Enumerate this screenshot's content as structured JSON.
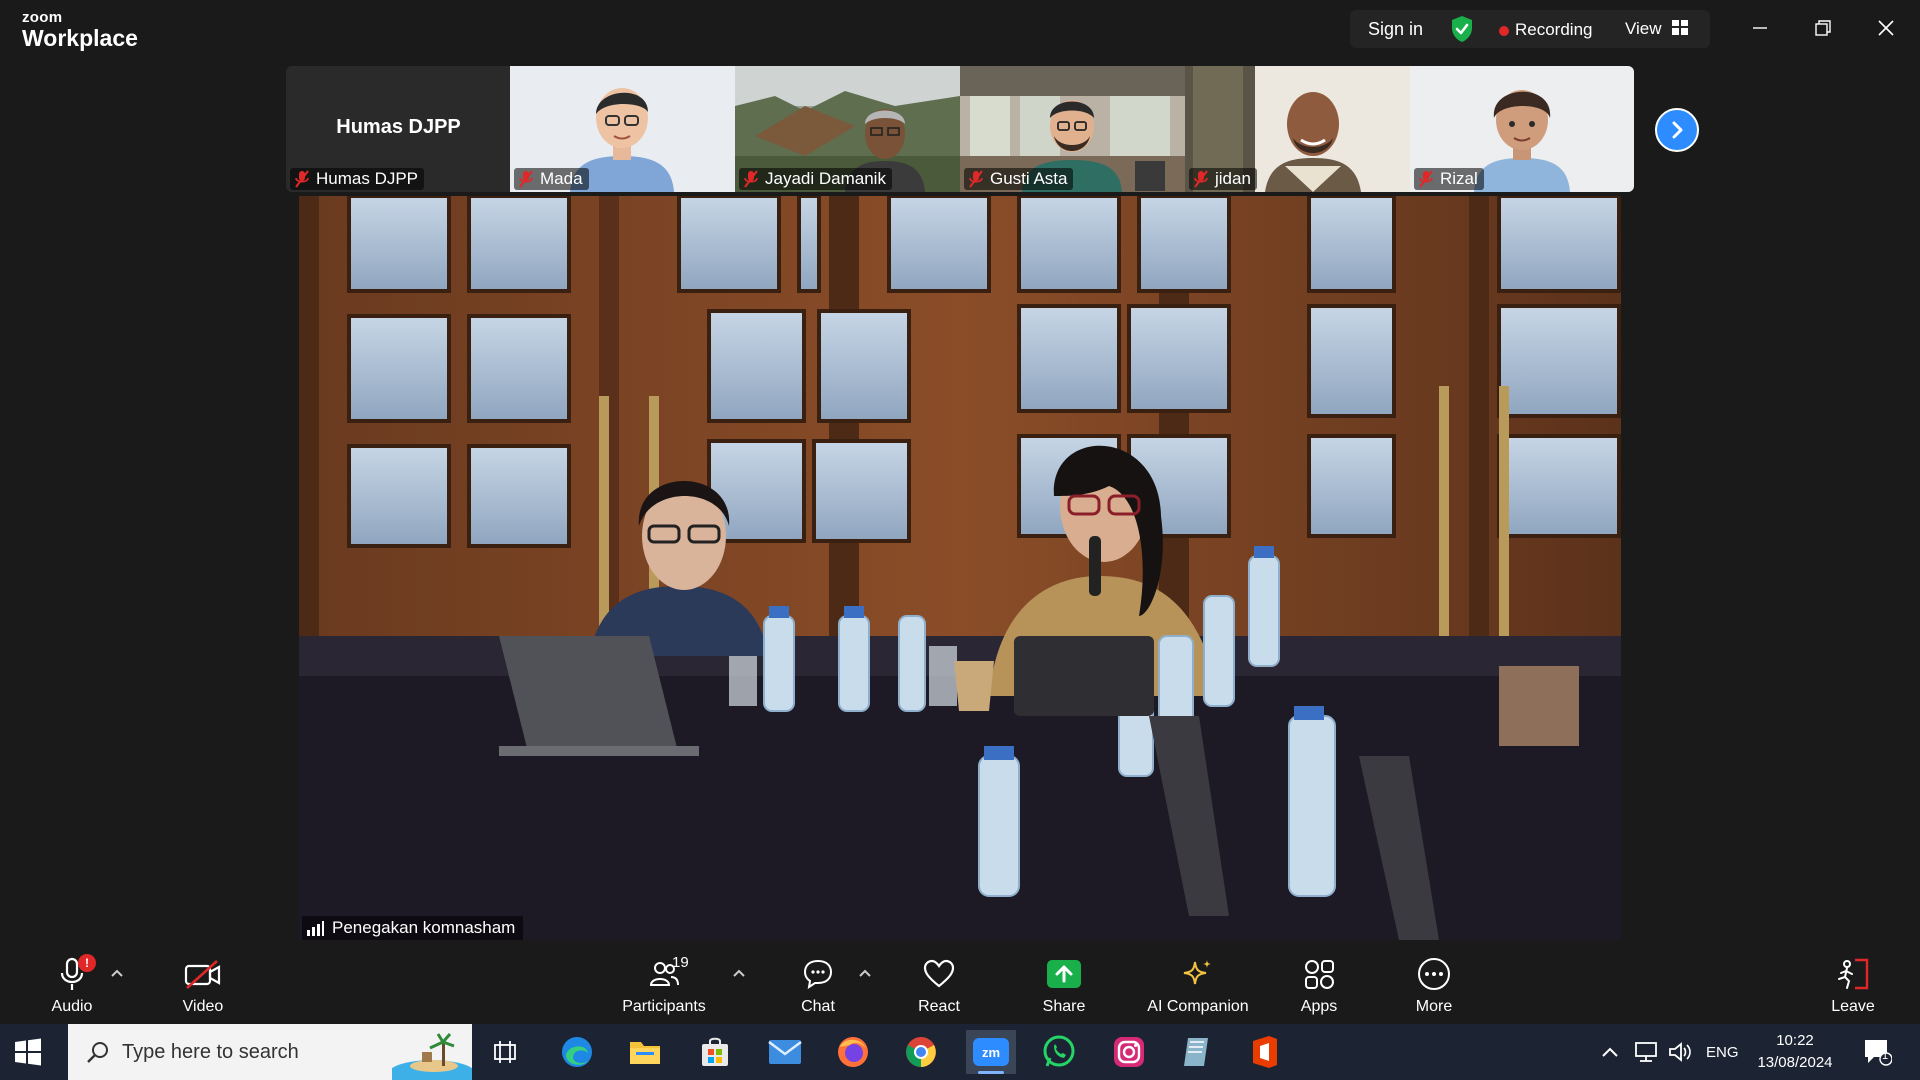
{
  "app": {
    "brand_small": "zoom",
    "brand_big": "Workplace",
    "sign_in": "Sign in",
    "recording": "Recording",
    "view": "View"
  },
  "colors": {
    "accent": "#2d8cff",
    "recording": "#e02828",
    "shield": "#19b04b",
    "share": "#19b04b",
    "ai": "#f5c242"
  },
  "gallery": {
    "participants": [
      {
        "name": "Humas DJPP",
        "display": "Humas DJPP",
        "video": "off"
      },
      {
        "name": "Mada",
        "video": "avatar"
      },
      {
        "name": "Jayadi Damanik",
        "video": "camera"
      },
      {
        "name": "Gusti Asta",
        "video": "avatar"
      },
      {
        "name": "jidan",
        "video": "camera"
      },
      {
        "name": "Rizal",
        "video": "avatar"
      }
    ],
    "next_icon": "chevron-right-icon"
  },
  "main": {
    "speaker": "Penegakan komnasham"
  },
  "toolbar": {
    "audio": {
      "label": "Audio",
      "badge": "!"
    },
    "video": {
      "label": "Video"
    },
    "participants": {
      "label": "Participants",
      "count": "19"
    },
    "chat": {
      "label": "Chat"
    },
    "react": {
      "label": "React"
    },
    "share": {
      "label": "Share"
    },
    "ai": {
      "label": "AI Companion"
    },
    "apps": {
      "label": "Apps"
    },
    "more": {
      "label": "More"
    },
    "leave": {
      "label": "Leave"
    }
  },
  "taskbar": {
    "search_placeholder": "Type here to search",
    "language": "ENG",
    "time": "10:22",
    "date": "13/08/2024",
    "notifications": "1",
    "apps": [
      "task-view",
      "edge",
      "file-explorer",
      "microsoft-store",
      "mail",
      "firefox",
      "chrome",
      "zoom",
      "whatsapp",
      "instagram",
      "notes",
      "office"
    ]
  }
}
